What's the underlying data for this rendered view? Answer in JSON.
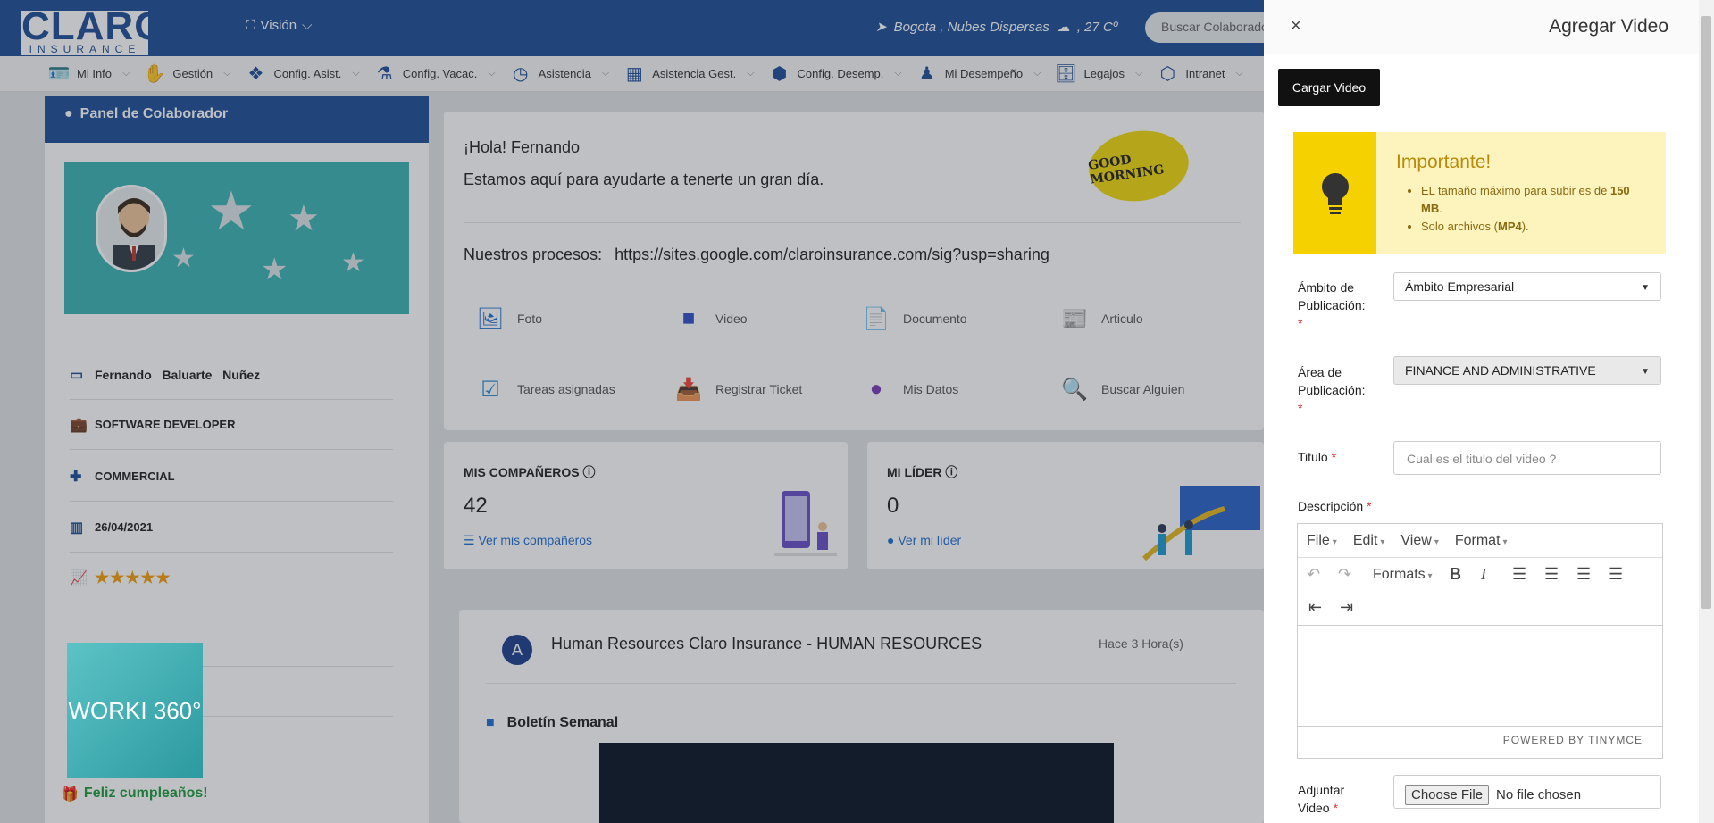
{
  "header": {
    "logo_top": "CLARO",
    "logo_bottom": "INSURANCE",
    "vision_label": "Visión",
    "weather": "Bogota , Nubes Dispersas",
    "temperature": ", 27 Cº",
    "search_placeholder": "Buscar Colaborador"
  },
  "nav": {
    "items": [
      {
        "label": "Mi Info",
        "icon": "id-card-icon"
      },
      {
        "label": "Gestión",
        "icon": "hand-icon"
      },
      {
        "label": "Config. Asist.",
        "icon": "dropbox-icon"
      },
      {
        "label": "Config. Vacac.",
        "icon": "flask-icon"
      },
      {
        "label": "Asistencia",
        "icon": "clock-icon"
      },
      {
        "label": "Asistencia Gest.",
        "icon": "calendar-icon"
      },
      {
        "label": "Config. Desemp.",
        "icon": "cube-icon"
      },
      {
        "label": "Mi Desempeño",
        "icon": "user-tie-icon"
      },
      {
        "label": "Legajos",
        "icon": "archive-icon"
      },
      {
        "label": "Intranet",
        "icon": "network-icon"
      }
    ]
  },
  "panel": {
    "title": "Panel de Colaborador",
    "name": "Fernando   Baluarte   Nuñez",
    "position": "SOFTWARE DEVELOPER",
    "department": "COMMERCIAL",
    "date": "26/04/2021",
    "stars": "★★★★★",
    "rating": 5,
    "worki": "WORKI 360°",
    "birthday": "Feliz cumpleaños!"
  },
  "greeting": {
    "hello": "¡Hola! Fernando",
    "message": "Estamos aquí para ayudarte a tenerte un gran día.",
    "badge": "GOOD MORNING",
    "processes_label": "Nuestros procesos:",
    "processes_url": "https://sites.google.com/claroinsurance.com/sig?usp=sharing",
    "actions": [
      {
        "label": "Foto",
        "icon": "image-icon"
      },
      {
        "label": "Video",
        "icon": "video-icon"
      },
      {
        "label": "Documento",
        "icon": "pdf-icon"
      },
      {
        "label": "Articulo",
        "icon": "article-icon"
      },
      {
        "label": "Tareas asignadas",
        "icon": "checkbox-icon"
      },
      {
        "label": "Registrar Ticket",
        "icon": "inbox-icon"
      },
      {
        "label": "Mis Datos",
        "icon": "user-circle-icon"
      },
      {
        "label": "Buscar Alguien",
        "icon": "search-icon"
      }
    ]
  },
  "companions": {
    "title": "MIS COMPAÑEROS",
    "count": "42",
    "link": "Ver mis compañeros"
  },
  "leader": {
    "title": "MI LÍDER",
    "count": "0",
    "link": "Ver mi líder"
  },
  "feed": {
    "avatar_letter": "A",
    "title": "Human Resources Claro Insurance - HUMAN RESOURCES",
    "time": "Hace 3 Hora(s)",
    "subtitle": "Boletín Semanal"
  },
  "modal": {
    "close": "×",
    "title": "Agregar Video",
    "upload_button": "Cargar Video",
    "important_title": "Importante!",
    "important_line1_a": "EL tamaño máximo para subir es de ",
    "important_line1_b": "150 MB",
    "important_line1_c": ".",
    "important_line2_a": "Solo archivos (",
    "important_line2_b": "MP4",
    "important_line2_c": ").",
    "scope_label": "Ámbito de Publicación:",
    "scope_value": "Ámbito Empresarial",
    "area_label": "Área de Publicación:",
    "area_value": "FINANCE AND ADMINISTRATIVE",
    "title_label": "Titulo",
    "title_placeholder": "Cual es el titulo del video ?",
    "description_label": "Descripción",
    "editor_menu": [
      "File",
      "Edit",
      "View",
      "Format"
    ],
    "formats_label": "Formats",
    "powered": "POWERED BY TINYMCE",
    "attach_label": "Adjuntar Video",
    "choose_file": "Choose File",
    "no_file": "No file chosen",
    "required": "*"
  }
}
